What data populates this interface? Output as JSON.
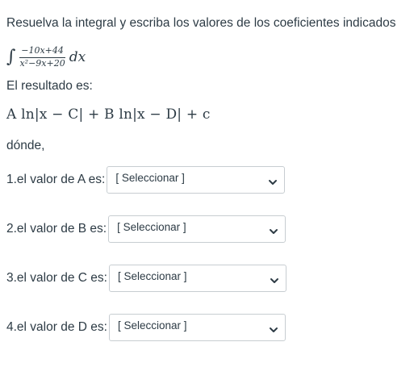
{
  "prompt": "Resuelva la integral y escriba los valores de los coeficientes indicados",
  "integral": {
    "sign": "∫",
    "numerator": "−10x+44",
    "denominator": "x²−9x+20",
    "differential": "dx"
  },
  "result_label": "El resultado es:",
  "formula": "A ln|x − C| + B ln|x − D| + c",
  "donde": "dónde,",
  "questions": [
    {
      "label": "1.el valor de A es:",
      "select_value": "[ Seleccionar ]"
    },
    {
      "label": "2.el valor de B es:",
      "select_value": "[ Seleccionar ]"
    },
    {
      "label": "3.el valor de C es:",
      "select_value": "[ Seleccionar ]"
    },
    {
      "label": "4.el valor de D es:",
      "select_value": "[ Seleccionar ]"
    }
  ],
  "icons": {
    "dropdown": "chevron-down-icon"
  }
}
